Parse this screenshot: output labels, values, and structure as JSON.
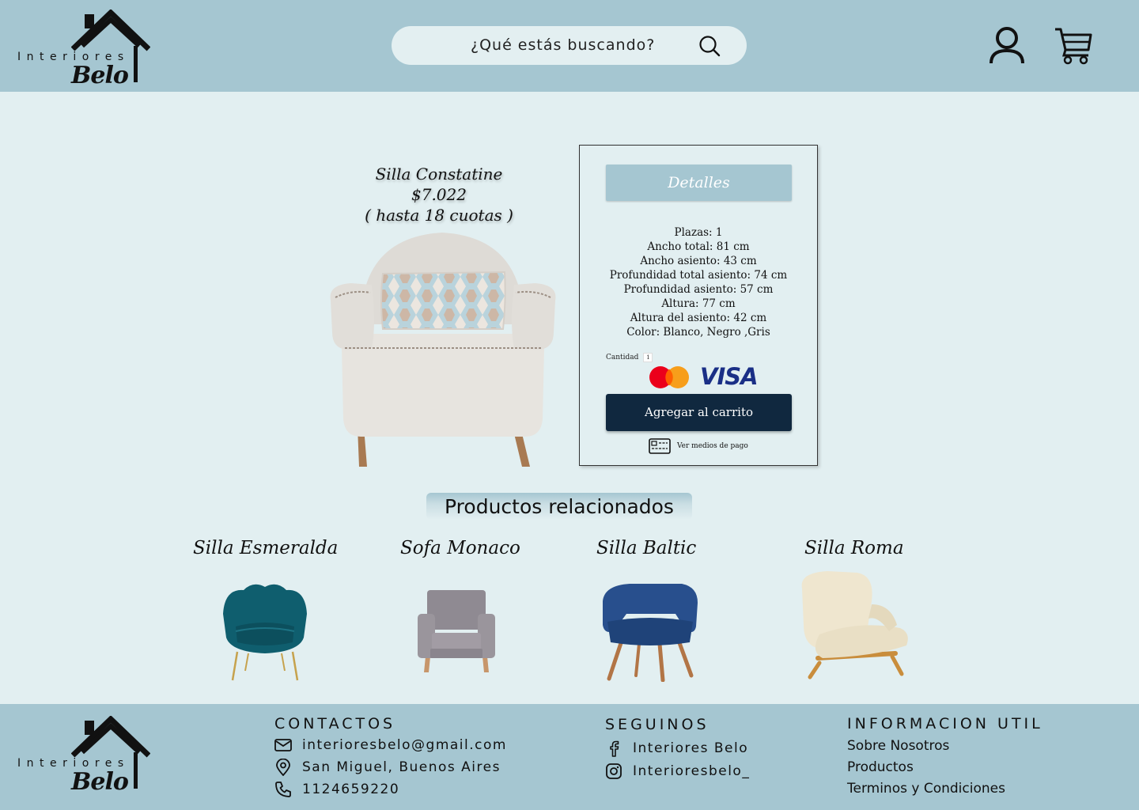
{
  "brand": {
    "line1": "Interiores",
    "line2": "Belo"
  },
  "header": {
    "search_placeholder": "¿Qué estás buscando?"
  },
  "product": {
    "name": "Silla Constatine",
    "price": "$7.022",
    "installments": "( hasta 18 cuotas )",
    "details_title": "Detalles",
    "specs": [
      "Plazas: 1",
      "Ancho total: 81 cm",
      "Ancho asiento: 43 cm",
      "Profundidad total asiento: 74 cm",
      "Profundidad asiento: 57 cm",
      "Altura: 77 cm",
      "Altura del asiento: 42 cm",
      "Color: Blanco, Negro ,Gris"
    ],
    "quantity_label": "Cantidad",
    "quantity_value": "1",
    "card_brand": "VISA",
    "add_to_cart": "Agregar al carrito",
    "payment_methods": "Ver medios de pago"
  },
  "related": {
    "title": "Productos relacionados",
    "items": [
      {
        "name": "Silla Esmeralda",
        "color": "#0f5e6e"
      },
      {
        "name": "Sofa Monaco",
        "color": "#8f8a92"
      },
      {
        "name": "Silla Baltic",
        "color": "#284f8d"
      },
      {
        "name": "Silla Roma",
        "color": "#efe6cf"
      }
    ]
  },
  "footer": {
    "contacts_title": "CONTACTOS",
    "email": "interioresbelo@gmail.com",
    "address": "San Miguel, Buenos Aires",
    "phone": "1124659220",
    "follow_title": "SEGUINOS",
    "facebook": "Interiores Belo",
    "instagram": "Interioresbelo_",
    "info_title": "INFORMACION UTIL",
    "links": [
      "Sobre Nosotros",
      "Productos",
      "Terminos y Condiciones"
    ]
  },
  "colors": {
    "header_bg": "#a5c6d1",
    "page_bg": "#e2eff1",
    "button_bg": "#10283f"
  }
}
